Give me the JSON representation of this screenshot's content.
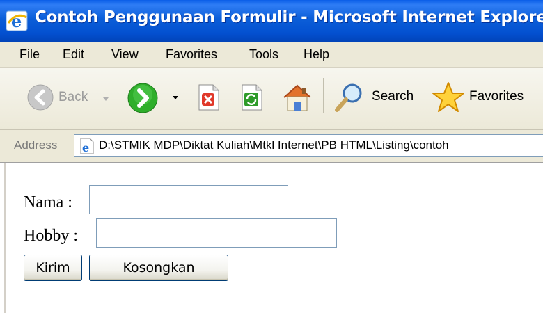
{
  "window": {
    "title": "Contoh Penggunaan Formulir - Microsoft Internet Explorer",
    "icon": "ie-icon"
  },
  "menu": {
    "items": [
      {
        "label": "File"
      },
      {
        "label": "Edit"
      },
      {
        "label": "View"
      },
      {
        "label": "Favorites"
      },
      {
        "label": "Tools"
      },
      {
        "label": "Help"
      }
    ]
  },
  "toolbar": {
    "back_label": "Back",
    "search_label": "Search",
    "favorites_label": "Favorites",
    "icons": [
      "back-icon",
      "forward-icon",
      "stop-icon",
      "refresh-icon",
      "home-icon",
      "search-icon",
      "favorites-star-icon"
    ]
  },
  "address": {
    "label": "Address",
    "value": "D:\\STMIK MDP\\Diktat Kuliah\\Mtkl Internet\\PB HTML\\Listing\\contoh"
  },
  "form": {
    "nama_label": "Nama :",
    "nama_value": "",
    "hobby_label": "Hobby :",
    "hobby_value": "",
    "submit_label": "Kirim",
    "reset_label": "Kosongkan"
  },
  "colors": {
    "titlebar": "#0a5ee8",
    "chrome": "#ece9d8",
    "input_border": "#7f9db9",
    "button_border": "#003c74"
  }
}
